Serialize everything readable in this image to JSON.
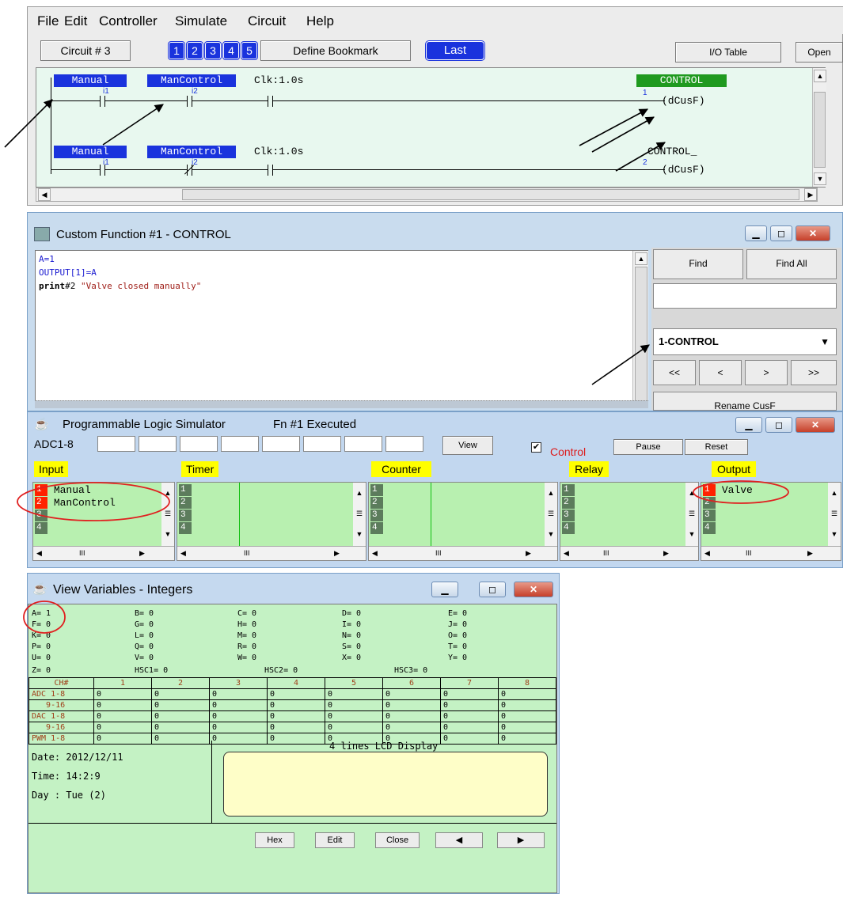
{
  "menu": [
    "File",
    "Edit",
    "Controller",
    "Simulate",
    "Circuit",
    "Help"
  ],
  "toolbar": {
    "circuit": "Circuit # 3",
    "bookmarks": [
      "1",
      "2",
      "3",
      "4",
      "5"
    ],
    "define_bookmark": "Define Bookmark",
    "last": "Last",
    "io_table": "I/O Table",
    "open": "Open"
  },
  "ladder": {
    "rungs": [
      {
        "c1": "Manual",
        "c1_id": "i1",
        "c2": "ManControl",
        "c2_id": "i2",
        "clk": "Clk:1.0s",
        "coil_label": "CONTROL",
        "coil_num": "1",
        "coil": "(dCusF)"
      },
      {
        "c1": "Manual",
        "c1_id": "i1",
        "c2": "ManControl",
        "c2_id": "i2",
        "clk": "Clk:1.0s",
        "coil_label": "CONTROL_",
        "coil_num": "2",
        "coil": "(dCusF)"
      }
    ]
  },
  "custom_function": {
    "title": "Custom Function #1 - CONTROL",
    "code": [
      {
        "a": "A=1",
        "b": ""
      },
      {
        "a": "OUTPUT[1]=A",
        "b": ""
      },
      {
        "a": "print",
        "b": "#2 ",
        "c": "\"Valve closed manually\""
      }
    ],
    "find": "Find",
    "find_all": "Find All",
    "search_value": "",
    "select_value": "1-CONTROL",
    "nav": [
      "<<",
      "<",
      ">",
      ">>"
    ],
    "rename": "Rename CusF"
  },
  "pls": {
    "title": "Programmable Logic Simulator",
    "status": "Fn #1 Executed",
    "adc_label": "ADC1-8",
    "view": "View",
    "control_label": "Control",
    "control_checked": true,
    "pause": "Pause",
    "reset": "Reset",
    "panels": [
      {
        "label": "Input",
        "rows": [
          {
            "n": "1",
            "on": true,
            "name": "Manual"
          },
          {
            "n": "2",
            "on": true,
            "name": "ManControl"
          },
          {
            "n": "3",
            "on": false,
            "name": ""
          },
          {
            "n": "4",
            "on": false,
            "name": ""
          }
        ]
      },
      {
        "label": "Timer",
        "rows": [
          {
            "n": "1",
            "on": false,
            "name": ""
          },
          {
            "n": "2",
            "on": false,
            "name": ""
          },
          {
            "n": "3",
            "on": false,
            "name": ""
          },
          {
            "n": "4",
            "on": false,
            "name": ""
          }
        ]
      },
      {
        "label": "Counter",
        "rows": [
          {
            "n": "1",
            "on": false,
            "name": ""
          },
          {
            "n": "2",
            "on": false,
            "name": ""
          },
          {
            "n": "3",
            "on": false,
            "name": ""
          },
          {
            "n": "4",
            "on": false,
            "name": ""
          }
        ]
      },
      {
        "label": "Relay",
        "rows": [
          {
            "n": "1",
            "on": false,
            "name": ""
          },
          {
            "n": "2",
            "on": false,
            "name": ""
          },
          {
            "n": "3",
            "on": false,
            "name": ""
          },
          {
            "n": "4",
            "on": false,
            "name": ""
          }
        ]
      },
      {
        "label": "Output",
        "rows": [
          {
            "n": "1",
            "on": true,
            "name": "Valve"
          },
          {
            "n": "2",
            "on": false,
            "name": ""
          },
          {
            "n": "3",
            "on": false,
            "name": ""
          },
          {
            "n": "4",
            "on": false,
            "name": ""
          }
        ]
      }
    ],
    "scroll_mark": "III"
  },
  "view_vars": {
    "title": "View Variables - Integers",
    "vars": [
      [
        "A= 1",
        "B= 0",
        "C= 0",
        "D= 0",
        "E= 0"
      ],
      [
        "F= 0",
        "G= 0",
        "H= 0",
        "I= 0",
        "J= 0"
      ],
      [
        "K= 0",
        "L= 0",
        "M= 0",
        "N= 0",
        "O= 0"
      ],
      [
        "P= 0",
        "Q= 0",
        "R= 0",
        "S= 0",
        "T= 0"
      ],
      [
        "U= 0",
        "V= 0",
        "W= 0",
        "X= 0",
        "Y= 0"
      ]
    ],
    "hsc": [
      "Z= 0",
      "HSC1= 0",
      "HSC2= 0",
      "HSC3= 0"
    ],
    "ch_header": [
      "CH#",
      "1",
      "2",
      "3",
      "4",
      "5",
      "6",
      "7",
      "8"
    ],
    "ch_rows": [
      {
        "label": "ADC 1-8",
        "values": [
          "0",
          "0",
          "0",
          "0",
          "0",
          "0",
          "0",
          "0"
        ]
      },
      {
        "label": "   9-16",
        "values": [
          "0",
          "0",
          "0",
          "0",
          "0",
          "0",
          "0",
          "0"
        ]
      },
      {
        "label": "DAC 1-8",
        "values": [
          "0",
          "0",
          "0",
          "0",
          "0",
          "0",
          "0",
          "0"
        ]
      },
      {
        "label": "   9-16",
        "values": [
          "0",
          "0",
          "0",
          "0",
          "0",
          "0",
          "0",
          "0"
        ]
      },
      {
        "label": "PWM 1-8",
        "values": [
          "0",
          "0",
          "0",
          "0",
          "0",
          "0",
          "0",
          "0"
        ]
      }
    ],
    "date": "Date: 2012/12/11",
    "time": "Time: 14:2:9",
    "day": "Day : Tue (2)",
    "lcd_title": "4 lines LCD Display",
    "buttons": {
      "hex": "Hex",
      "edit": "Edit",
      "close": "Close"
    }
  }
}
